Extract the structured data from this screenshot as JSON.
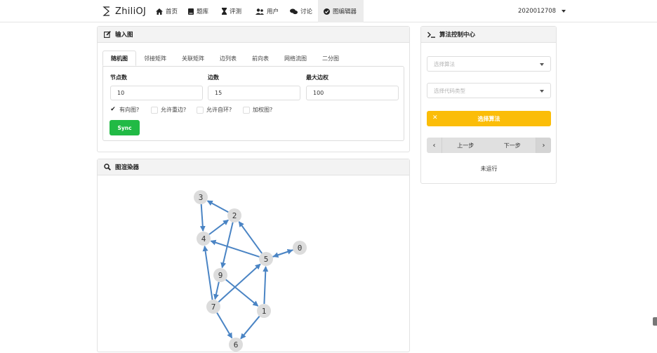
{
  "nav": {
    "logo": "ZhiliOJ",
    "items": [
      {
        "icon": "home-icon",
        "label": "首页"
      },
      {
        "icon": "book-icon",
        "label": "题库"
      },
      {
        "icon": "hourglass-icon",
        "label": "评测"
      },
      {
        "icon": "users-icon",
        "label": "用户"
      },
      {
        "icon": "comments-icon",
        "label": "讨论"
      },
      {
        "icon": "check-circle-icon",
        "label": "图编辑器"
      }
    ],
    "active": "图编辑器",
    "user": "2020012708"
  },
  "input_panel": {
    "title": "输入图",
    "tabs": [
      "随机图",
      "邻接矩阵",
      "关联矩阵",
      "边列表",
      "前向表",
      "网络流图",
      "二分图"
    ],
    "active_tab": "随机图",
    "fields": [
      {
        "label": "节点数",
        "value": "10"
      },
      {
        "label": "边数",
        "value": "15"
      },
      {
        "label": "最大边权",
        "value": "100"
      }
    ],
    "checkboxes": [
      {
        "label": "有向图?",
        "checked": true
      },
      {
        "label": "允许重边?",
        "checked": false
      },
      {
        "label": "允许自环?",
        "checked": false
      },
      {
        "label": "加权图?",
        "checked": false
      }
    ],
    "sync_label": "Sync",
    "sync_color": "#21ba45"
  },
  "render_panel": {
    "title": "图渲染器",
    "nodes": [
      "3",
      "2",
      "4",
      "5",
      "0",
      "9",
      "7",
      "1",
      "6"
    ],
    "edges": [
      [
        "2",
        "3"
      ],
      [
        "3",
        "4"
      ],
      [
        "4",
        "2"
      ],
      [
        "2",
        "9"
      ],
      [
        "5",
        "4"
      ],
      [
        "5",
        "2"
      ],
      [
        "5",
        "0"
      ],
      [
        "0",
        "5"
      ],
      [
        "9",
        "7"
      ],
      [
        "9",
        "1"
      ],
      [
        "7",
        "4"
      ],
      [
        "7",
        "5"
      ],
      [
        "1",
        "5"
      ],
      [
        "1",
        "6"
      ],
      [
        "7",
        "6"
      ]
    ],
    "edge_color": "#4a84c4",
    "node_color": "#dcdcdc"
  },
  "control_panel": {
    "title": "算法控制中心",
    "algorithm_placeholder": "选择算法",
    "code_type_placeholder": "选择代码类型",
    "choose_button": "选择算法",
    "choose_color": "#fbbd08",
    "prev_label": "上一步",
    "next_label": "下一步",
    "status": "未运行"
  }
}
